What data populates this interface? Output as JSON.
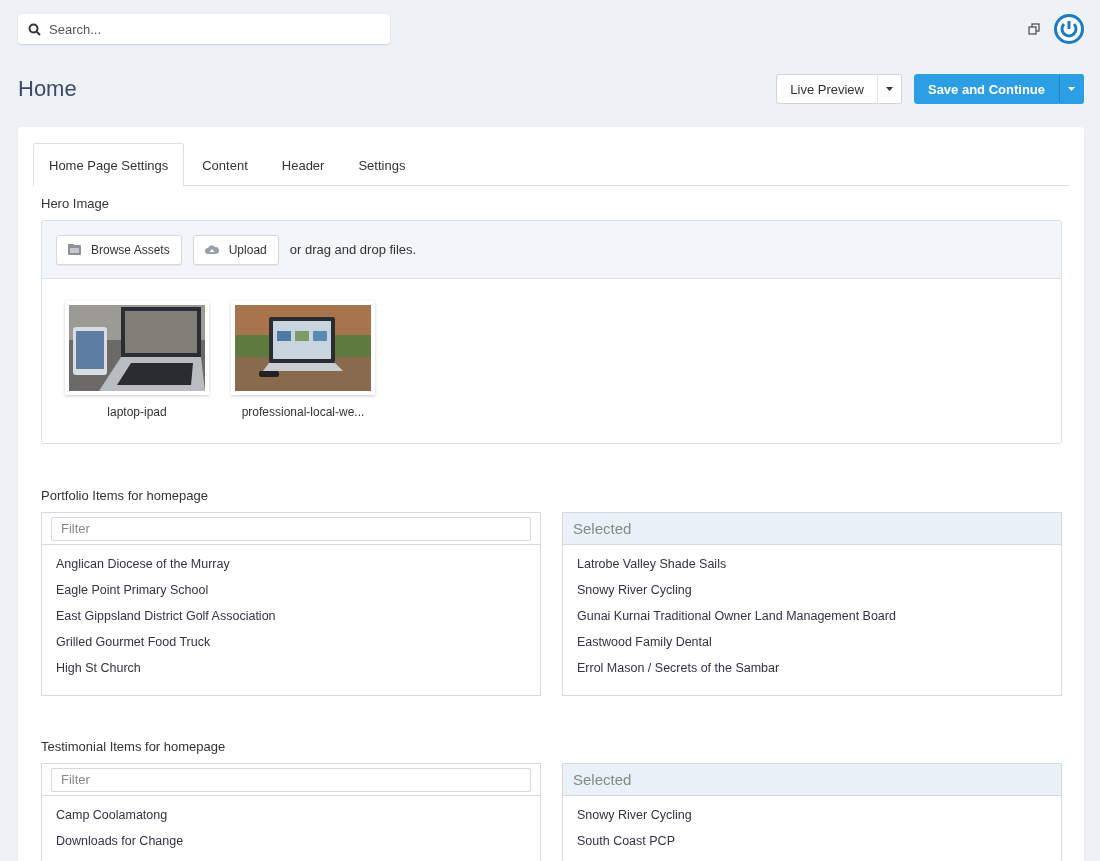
{
  "search": {
    "placeholder": "Search..."
  },
  "page": {
    "title": "Home"
  },
  "actions": [
    {
      "label": "Live Preview",
      "kind": "default"
    },
    {
      "label": "Save and Continue",
      "kind": "primary"
    }
  ],
  "tabs": [
    {
      "label": "Home Page Settings",
      "selected": true
    },
    {
      "label": "Content",
      "selected": false
    },
    {
      "label": "Header",
      "selected": false
    },
    {
      "label": "Settings",
      "selected": false
    }
  ],
  "hero": {
    "label": "Hero Image",
    "buttons": [
      {
        "label": "Browse Assets"
      },
      {
        "label": "Upload"
      }
    ],
    "hint": "or drag and drop files.",
    "files": [
      {
        "name": "laptop-ipad",
        "kind": "picture"
      },
      {
        "name": "professional-local-we...",
        "kind": "picture"
      }
    ]
  },
  "pickers": [
    {
      "label": "Portfolio Items for homepage",
      "filter_placeholder": "Filter",
      "selected_header": "Selected",
      "available": [
        "Anglican Diocese of the Murray",
        "Eagle Point Primary School",
        "East Gippsland District Golf Association",
        "Grilled Gourmet Food Truck",
        "High St Church"
      ],
      "selected": [
        "Latrobe Valley Shade Sails",
        "Snowy River Cycling",
        "Gunai Kurnai Traditional Owner Land Management Board",
        "Eastwood Family Dental",
        "Errol Mason / Secrets of the Sambar"
      ]
    },
    {
      "label": "Testimonial Items for homepage",
      "filter_placeholder": "Filter",
      "selected_header": "Selected",
      "available": [
        "Camp Coolamatong",
        "Downloads for Change"
      ],
      "selected": [
        "Snowy River Cycling",
        "South Coast PCP"
      ]
    }
  ]
}
